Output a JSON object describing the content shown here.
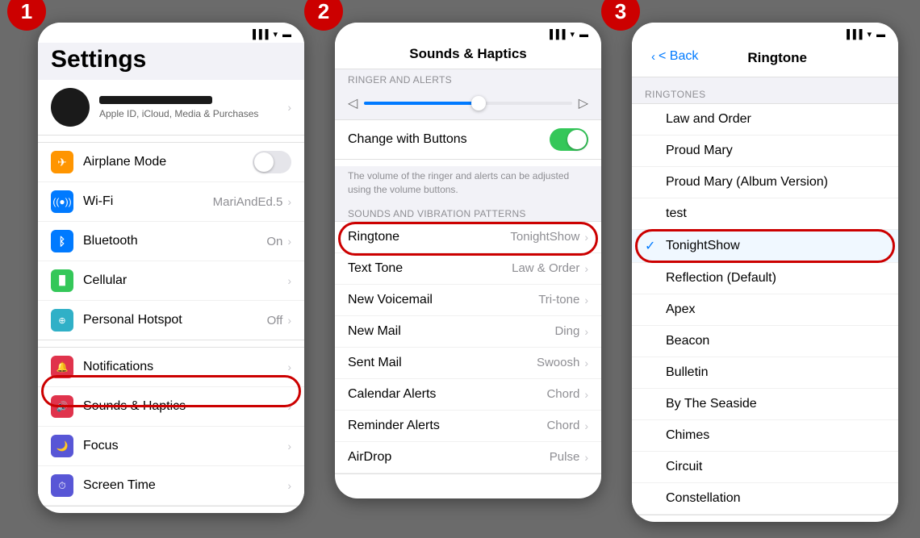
{
  "steps": [
    {
      "number": "1",
      "title": "Settings",
      "statusIcons": [
        "📶",
        "📡",
        "🔋"
      ],
      "profile": {
        "subtext": "Apple ID, iCloud, Media & Purchases"
      },
      "sections": [
        {
          "items": [
            {
              "icon": "✈",
              "iconClass": "icon-orange",
              "label": "Airplane Mode",
              "value": "",
              "hasToggle": true,
              "toggleOn": false
            },
            {
              "icon": "wifi",
              "iconClass": "icon-blue",
              "label": "Wi-Fi",
              "value": "MariAndEd.5",
              "hasToggle": false
            },
            {
              "icon": "bluetooth",
              "iconClass": "icon-bluetooth",
              "label": "Bluetooth",
              "value": "On",
              "hasToggle": false
            },
            {
              "icon": "cellular",
              "iconClass": "icon-green",
              "label": "Cellular",
              "value": "",
              "hasToggle": false
            },
            {
              "icon": "hotspot",
              "iconClass": "icon-teal",
              "label": "Personal Hotspot",
              "value": "Off",
              "hasToggle": false
            }
          ]
        },
        {
          "items": [
            {
              "icon": "notif",
              "iconClass": "icon-red",
              "label": "Notifications",
              "value": "",
              "hasToggle": false,
              "highlighted": false
            },
            {
              "icon": "sound",
              "iconClass": "icon-red",
              "label": "Sounds & Haptics",
              "value": "",
              "hasToggle": false,
              "highlighted": true
            },
            {
              "icon": "focus",
              "iconClass": "icon-indigo",
              "label": "Focus",
              "value": "",
              "hasToggle": false
            },
            {
              "icon": "screen",
              "iconClass": "icon-indigo",
              "label": "Screen Time",
              "value": "",
              "hasToggle": false
            }
          ]
        }
      ]
    },
    {
      "number": "2",
      "title": "Sounds & Haptics",
      "sections": [
        {
          "header": "RINGER AND ALERTS",
          "hasSlider": true,
          "sliderFill": 55,
          "changeWithButtons": true,
          "description": "The volume of the ringer and alerts can be adjusted using the volume buttons."
        },
        {
          "header": "SOUNDS AND VIBRATION PATTERNS",
          "items": [
            {
              "label": "Ringtone",
              "value": "TonightShow",
              "highlighted": true
            },
            {
              "label": "Text Tone",
              "value": "Law & Order"
            },
            {
              "label": "New Voicemail",
              "value": "Tri-tone"
            },
            {
              "label": "New Mail",
              "value": "Ding"
            },
            {
              "label": "Sent Mail",
              "value": "Swoosh"
            },
            {
              "label": "Calendar Alerts",
              "value": "Chord"
            },
            {
              "label": "Reminder Alerts",
              "value": "Chord"
            },
            {
              "label": "AirDrop",
              "value": "Pulse"
            }
          ]
        }
      ]
    },
    {
      "number": "3",
      "title": "Ringtone",
      "backLabel": "< Back",
      "sectionHeader": "RINGTONES",
      "items": [
        {
          "label": "Law and Order",
          "selected": false
        },
        {
          "label": "Proud Mary",
          "selected": false
        },
        {
          "label": "Proud Mary (Album Version)",
          "selected": false
        },
        {
          "label": "test",
          "selected": false
        },
        {
          "label": "TonightShow",
          "selected": true,
          "highlighted": true
        },
        {
          "label": "Reflection (Default)",
          "selected": false
        },
        {
          "label": "Apex",
          "selected": false
        },
        {
          "label": "Beacon",
          "selected": false
        },
        {
          "label": "Bulletin",
          "selected": false
        },
        {
          "label": "By The Seaside",
          "selected": false
        },
        {
          "label": "Chimes",
          "selected": false
        },
        {
          "label": "Circuit",
          "selected": false
        },
        {
          "label": "Constellation",
          "selected": false
        }
      ]
    }
  ]
}
